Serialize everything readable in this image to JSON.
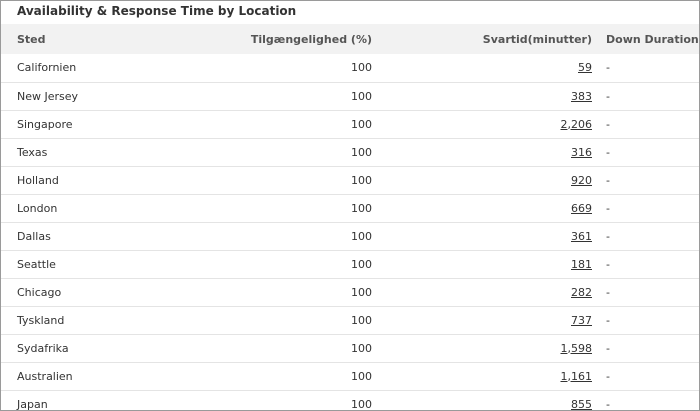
{
  "panel": {
    "title": "Availability & Response Time by Location"
  },
  "table": {
    "columns": [
      "Sted",
      "Tilgængelighed (%)",
      "Svartid(minutter)",
      "Down Duration"
    ],
    "rows": [
      {
        "location": "Californien",
        "availability": "100",
        "response": "59",
        "down": "-"
      },
      {
        "location": "New Jersey",
        "availability": "100",
        "response": "383",
        "down": "-"
      },
      {
        "location": "Singapore",
        "availability": "100",
        "response": "2,206",
        "down": "-"
      },
      {
        "location": "Texas",
        "availability": "100",
        "response": "316",
        "down": "-"
      },
      {
        "location": "Holland",
        "availability": "100",
        "response": "920",
        "down": "-"
      },
      {
        "location": "London",
        "availability": "100",
        "response": "669",
        "down": "-"
      },
      {
        "location": "Dallas",
        "availability": "100",
        "response": "361",
        "down": "-"
      },
      {
        "location": "Seattle",
        "availability": "100",
        "response": "181",
        "down": "-"
      },
      {
        "location": "Chicago",
        "availability": "100",
        "response": "282",
        "down": "-"
      },
      {
        "location": "Tyskland",
        "availability": "100",
        "response": "737",
        "down": "-"
      },
      {
        "location": "Sydafrika",
        "availability": "100",
        "response": "1,598",
        "down": "-"
      },
      {
        "location": "Australien",
        "availability": "100",
        "response": "1,161",
        "down": "-"
      },
      {
        "location": "Japan",
        "availability": "100",
        "response": "855",
        "down": "-"
      }
    ]
  }
}
